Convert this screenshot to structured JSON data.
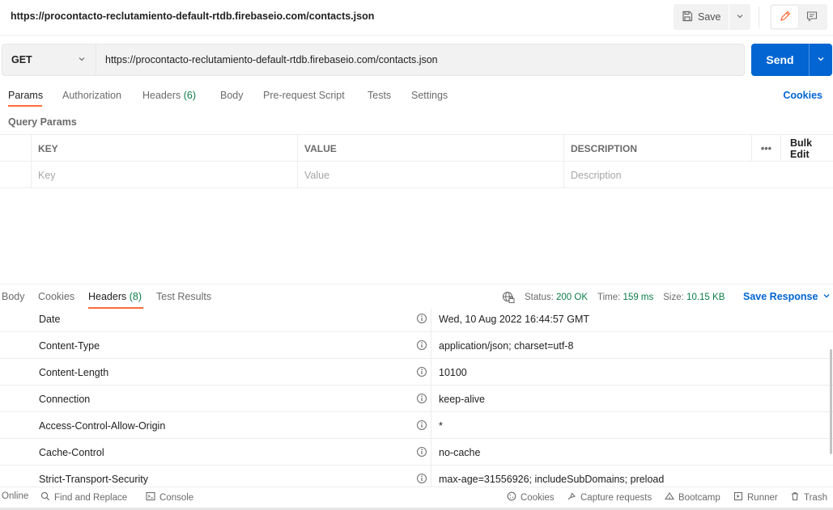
{
  "request": {
    "title": "https://procontacto-reclutamiento-default-rtdb.firebaseio.com/contacts.json",
    "method": "GET",
    "url": "https://procontacto-reclutamiento-default-rtdb.firebaseio.com/contacts.json",
    "save_label": "Save",
    "send_label": "Send"
  },
  "request_tabs": {
    "params": "Params",
    "authorization": "Authorization",
    "headers": "Headers",
    "headers_count": "(6)",
    "body": "Body",
    "pre_request": "Pre-request Script",
    "tests": "Tests",
    "settings": "Settings",
    "cookies": "Cookies"
  },
  "query_params": {
    "label": "Query Params",
    "columns": {
      "key": "KEY",
      "value": "VALUE",
      "description": "DESCRIPTION"
    },
    "more": "•••",
    "bulk_edit": "Bulk Edit",
    "placeholders": {
      "key": "Key",
      "value": "Value",
      "description": "Description"
    }
  },
  "response_tabs": {
    "body": "Body",
    "cookies": "Cookies",
    "headers": "Headers",
    "headers_count": "(8)",
    "test_results": "Test Results"
  },
  "response_status": {
    "status_label": "Status:",
    "status_value": "200 OK",
    "time_label": "Time:",
    "time_value": "159 ms",
    "size_label": "Size:",
    "size_value": "10.15 KB",
    "save_response": "Save Response"
  },
  "response_headers": [
    {
      "key": "Date",
      "value": "Wed, 10 Aug 2022 16:44:57 GMT"
    },
    {
      "key": "Content-Type",
      "value": "application/json; charset=utf-8"
    },
    {
      "key": "Content-Length",
      "value": "10100"
    },
    {
      "key": "Connection",
      "value": "keep-alive"
    },
    {
      "key": "Access-Control-Allow-Origin",
      "value": "*"
    },
    {
      "key": "Cache-Control",
      "value": "no-cache"
    },
    {
      "key": "Strict-Transport-Security",
      "value": "max-age=31556926; includeSubDomains; preload"
    }
  ],
  "footer": {
    "online": "Online",
    "find_replace": "Find and Replace",
    "console": "Console",
    "cookies": "Cookies",
    "capture": "Capture requests",
    "bootcamp": "Bootcamp",
    "runner": "Runner",
    "trash": "Trash"
  },
  "colors": {
    "accent_orange": "#ff6c37",
    "send_blue": "#0265d2",
    "status_green": "#0a7d47"
  }
}
